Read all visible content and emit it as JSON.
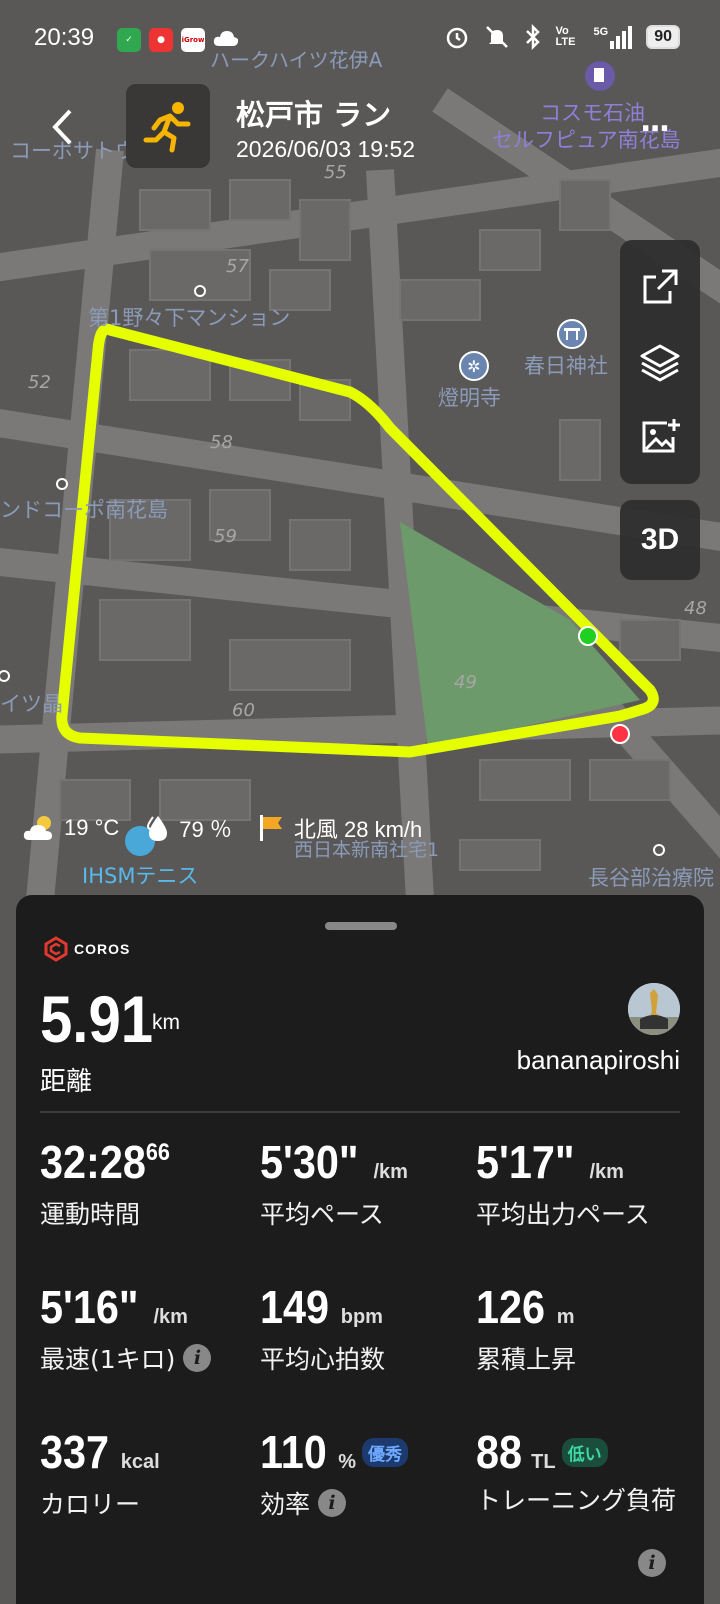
{
  "status_bar": {
    "time": "20:39",
    "battery": "90",
    "network": "5G",
    "volte": "Vo LTE"
  },
  "header": {
    "title": "松戸市 ラン",
    "datetime": "2026/06/03 19:52",
    "more": "..."
  },
  "map": {
    "labels": [
      "ハークハイツ花伊A",
      "コーポサトウ",
      "コスモ石油",
      "セルフピュア南花島",
      "55",
      "57",
      "第1野々下マンション",
      "春日神社",
      "燈明寺",
      "52",
      "58",
      "ンドコーポ南花島",
      "59",
      "48",
      "49",
      "イツ晶",
      "60",
      "西日本新南社宅1",
      "IHSMテニス",
      "長谷部治療院"
    ]
  },
  "tools": {
    "three_d": "3D"
  },
  "weather": {
    "temperature": "19 °C",
    "humidity": "79 ％",
    "wind": "北風 28 km/h"
  },
  "panel": {
    "brand": "COROS",
    "distance_value": "5.91",
    "distance_unit": "km",
    "distance_label": "距離",
    "username": "bananapiroshi",
    "metrics": [
      {
        "value": "32:28",
        "sup": "66",
        "unit": "",
        "label": "運動時間"
      },
      {
        "value": "5'30\"",
        "unit": "/km",
        "label": "平均ペース"
      },
      {
        "value": "5'17\"",
        "unit": "/km",
        "label": "平均出力ペース"
      },
      {
        "value": "5'16\"",
        "unit": "/km",
        "label": "最速(1キロ)"
      },
      {
        "value": "149",
        "unit": "bpm",
        "label": "平均心拍数"
      },
      {
        "value": "126",
        "unit": "m",
        "label": "累積上昇"
      },
      {
        "value": "337",
        "unit": "kcal",
        "label": "カロリー"
      },
      {
        "value": "110",
        "unit": "%",
        "label": "効率",
        "badge": "優秀"
      },
      {
        "value": "88",
        "unit": "TL",
        "label": "トレーニング負荷",
        "badge": "低い"
      }
    ]
  }
}
